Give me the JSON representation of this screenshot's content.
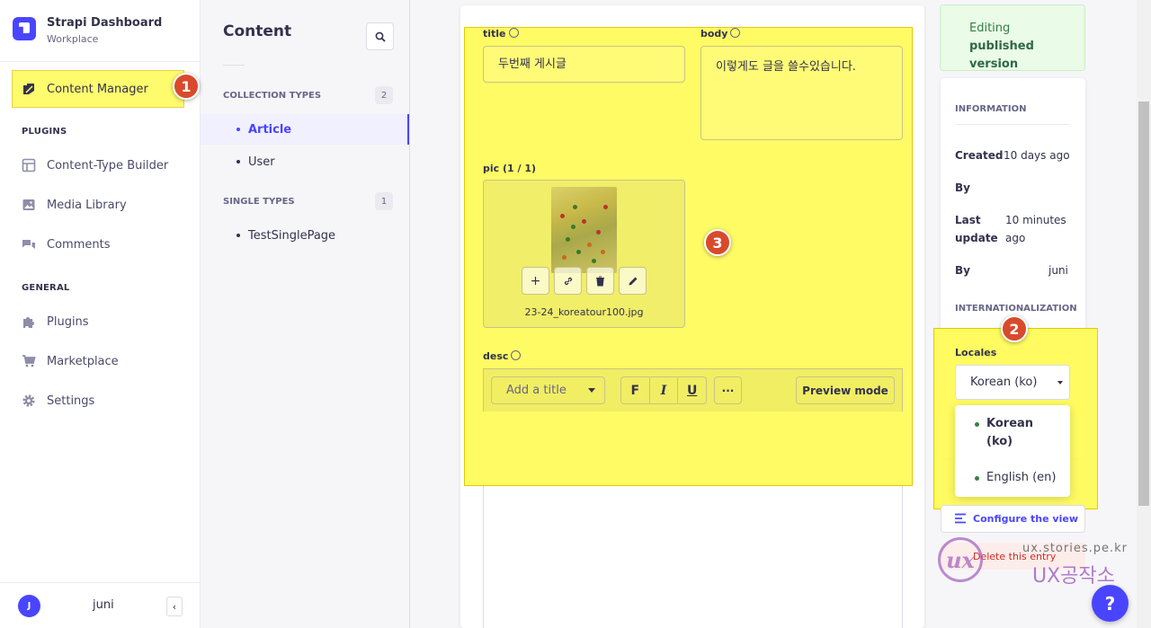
{
  "brand": {
    "title": "Strapi Dashboard",
    "subtitle": "Workplace"
  },
  "leftnav": {
    "active_item": "Content Manager",
    "sections": [
      {
        "label": "PLUGINS"
      },
      {
        "label": "GENERAL"
      }
    ],
    "plugins": [
      {
        "label": "Content-Type Builder",
        "icon": "layout-icon"
      },
      {
        "label": "Media Library",
        "icon": "image-icon"
      },
      {
        "label": "Comments",
        "icon": "chat-icon"
      }
    ],
    "general": [
      {
        "label": "Plugins",
        "icon": "puzzle-icon"
      },
      {
        "label": "Marketplace",
        "icon": "cart-icon"
      },
      {
        "label": "Settings",
        "icon": "gear-icon"
      }
    ],
    "user": {
      "initial": "J",
      "name": "juni"
    },
    "collapse_glyph": "‹"
  },
  "subnav": {
    "title": "Content",
    "collection_label": "COLLECTION TYPES",
    "collection_count": "2",
    "collection_items": [
      "Article",
      "User"
    ],
    "single_label": "SINGLE TYPES",
    "single_count": "1",
    "single_items": [
      "TestSinglePage"
    ]
  },
  "editor": {
    "title_label": "title",
    "title_value": "두번째 게시글",
    "body_label": "body",
    "body_value": "이렇게도 글을 쓸수있습니다.",
    "pic_label": "pic (1 / 1)",
    "pic_filename": "23-24_koreatour100.jpg",
    "desc_label": "desc",
    "toolbar": {
      "heading_placeholder": "Add a title",
      "bold": "F",
      "italic": "I",
      "underline": "U",
      "more": "···",
      "preview": "Preview mode"
    }
  },
  "right": {
    "status_prefix": "Editing ",
    "status_strong": "published version",
    "info_heading": "INFORMATION",
    "created_label": "Created",
    "created_value": "10 days ago",
    "by_label": "By",
    "created_by": "",
    "last_update_label": "Last update",
    "last_update_value": "10 minutes ago",
    "updated_by_label": "By",
    "updated_by": "juni",
    "i18n_heading": "INTERNATIONALIZATION",
    "locales_label": "Locales",
    "locale_selected": "Korean (ko)",
    "locale_options": [
      "Korean (ko)",
      "English (en)"
    ],
    "configure_view": "Configure the view",
    "delete_entry": "Delete this entry"
  },
  "markers": [
    "1",
    "2",
    "3"
  ],
  "watermark": {
    "url": "ux.stories.pe.kr",
    "name": "UX공작소",
    "logo": "ux"
  },
  "help": "?",
  "colors": {
    "primary": "#4945ff",
    "highlight": "#fffb6e",
    "marker": "#d84a2b",
    "success_bg": "#eafbe7"
  }
}
